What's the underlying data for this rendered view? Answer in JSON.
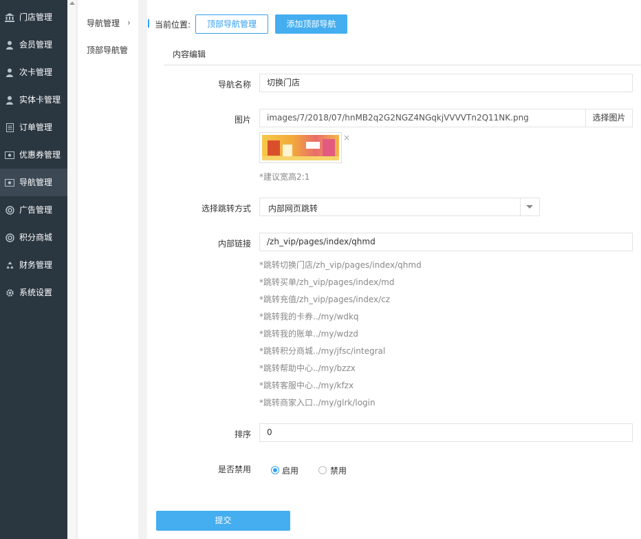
{
  "sidebar": {
    "items": [
      {
        "label": "门店管理",
        "icon": "bank-icon"
      },
      {
        "label": "会员管理",
        "icon": "user-icon"
      },
      {
        "label": "次卡管理",
        "icon": "user-icon"
      },
      {
        "label": "实体卡管理",
        "icon": "user-icon"
      },
      {
        "label": "订单管理",
        "icon": "document-icon"
      },
      {
        "label": "优惠券管理",
        "icon": "ticket-icon"
      },
      {
        "label": "导航管理",
        "icon": "ticket-icon"
      },
      {
        "label": "广告管理",
        "icon": "lifebuoy-icon"
      },
      {
        "label": "积分商城",
        "icon": "lifebuoy-icon"
      },
      {
        "label": "财务管理",
        "icon": "recycle-icon"
      },
      {
        "label": "系统设置",
        "icon": "gear-icon"
      }
    ],
    "active_index": 6
  },
  "subnav": {
    "title": "导航管理",
    "arrow": "›",
    "items": [
      "顶部导航管"
    ]
  },
  "topbar": {
    "location_label": "当前位置:",
    "crumb_button": "顶部导航管理",
    "add_button": "添加顶部导航"
  },
  "panel": {
    "title": "内容编辑"
  },
  "form": {
    "nav_name": {
      "label": "导航名称",
      "value": "切换门店"
    },
    "image": {
      "label": "图片",
      "value": "images/7/2018/07/hnMB2q2G2NGZ4NGqkjVVVVTn2Q11NK.png",
      "pick_button": "选择图片",
      "remove": "×",
      "hint": "*建议宽高2:1"
    },
    "jump_type": {
      "label": "选择跳转方式",
      "value": "内部网页跳转"
    },
    "internal_link": {
      "label": "内部链接",
      "value": "/zh_vip/pages/index/qhmd",
      "hints": [
        "*跳转切换门店/zh_vip/pages/index/qhmd",
        "*跳转买单/zh_vip/pages/index/md",
        "*跳转充值/zh_vip/pages/index/cz",
        "*跳转我的卡券../my/wdkq",
        "*跳转我的账单../my/wdzd",
        "*跳转积分商城../my/jfsc/integral",
        "*跳转帮助中心../my/bzzx",
        "*跳转客服中心../my/kfzx",
        "*跳转商家入口../my/glrk/login"
      ]
    },
    "sort": {
      "label": "排序",
      "value": "0"
    },
    "disabled": {
      "label": "是否禁用",
      "options": [
        {
          "label": "启用",
          "checked": true
        },
        {
          "label": "禁用",
          "checked": false
        }
      ]
    },
    "submit": "提交"
  },
  "colors": {
    "sidebar_bg": "#2a3640",
    "accent": "#31a0f0",
    "button_fill": "#44aef0"
  }
}
